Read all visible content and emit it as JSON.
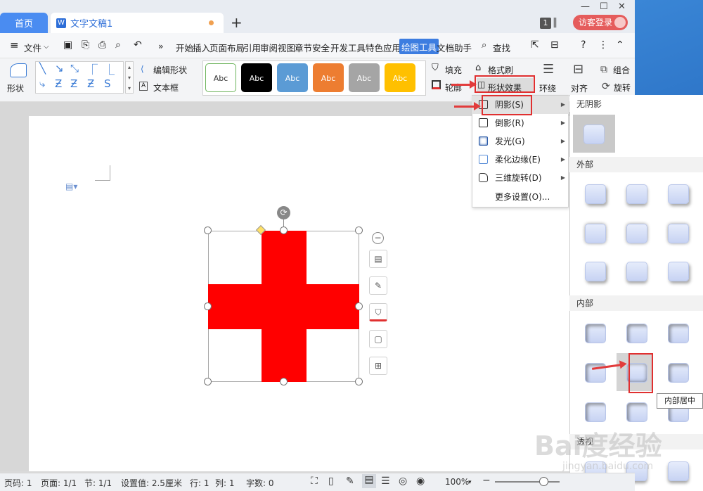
{
  "titlebar": {
    "home_tab": "首页",
    "doc_tab": "文字文稿1",
    "doc_icon": "W",
    "plus": "+",
    "badge": "1",
    "login": "访客登录",
    "win_min": "—",
    "win_max": "☐",
    "win_close": "✕"
  },
  "menu": {
    "file": "文件",
    "items": [
      "开始",
      "插入",
      "页面布局",
      "引用",
      "审阅",
      "视图",
      "章节",
      "安全",
      "开发工具",
      "特色应用",
      "绘图工具",
      "文档助手"
    ],
    "search": "查找",
    "more": "»"
  },
  "ribbon": {
    "shape_label": "形状",
    "edit_shape": "编辑形状",
    "textbox": "文本框",
    "styles": [
      {
        "label": "Abc",
        "bg": "#ffffff",
        "fg": "#333333",
        "border": "#6bb35a"
      },
      {
        "label": "Abc",
        "bg": "#000000",
        "fg": "#ffffff",
        "border": "#000000"
      },
      {
        "label": "Abc",
        "bg": "#5b9bd5",
        "fg": "#ffffff",
        "border": "#5b9bd5"
      },
      {
        "label": "Abc",
        "bg": "#ed7d31",
        "fg": "#ffffff",
        "border": "#ed7d31"
      },
      {
        "label": "Abc",
        "bg": "#a5a5a5",
        "fg": "#ffffff",
        "border": "#a5a5a5"
      },
      {
        "label": "Abc",
        "bg": "#ffc000",
        "fg": "#ffffff",
        "border": "#ffc000"
      }
    ],
    "fill": "填充",
    "format_brush": "格式刷",
    "outline": "轮廓",
    "shape_effect": "形状效果",
    "wrap": "环绕",
    "align": "对齐",
    "group": "组合",
    "rotate": "旋转"
  },
  "effect_menu": {
    "items": [
      "阴影(S)",
      "倒影(R)",
      "发光(G)",
      "柔化边缘(E)",
      "三维旋转(D)",
      "更多设置(O)..."
    ]
  },
  "shadow_panel": {
    "none": "无阴影",
    "outer": "外部",
    "inner": "内部",
    "perspective": "透视",
    "tooltip": "内部居中"
  },
  "status": {
    "page_num": "页码: 1",
    "pages": "页面: 1/1",
    "section": "节: 1/1",
    "setting": "设置值: 2.5厘米",
    "row": "行: 1",
    "col": "列: 1",
    "words": "字数: 0",
    "zoom": "100%"
  },
  "watermark": {
    "main": "Bai度经验",
    "sub": "jingyan.baidu.com"
  },
  "colors": {
    "accent": "#3d7de0",
    "cross": "#ff0000",
    "annotation": "#e03030"
  }
}
